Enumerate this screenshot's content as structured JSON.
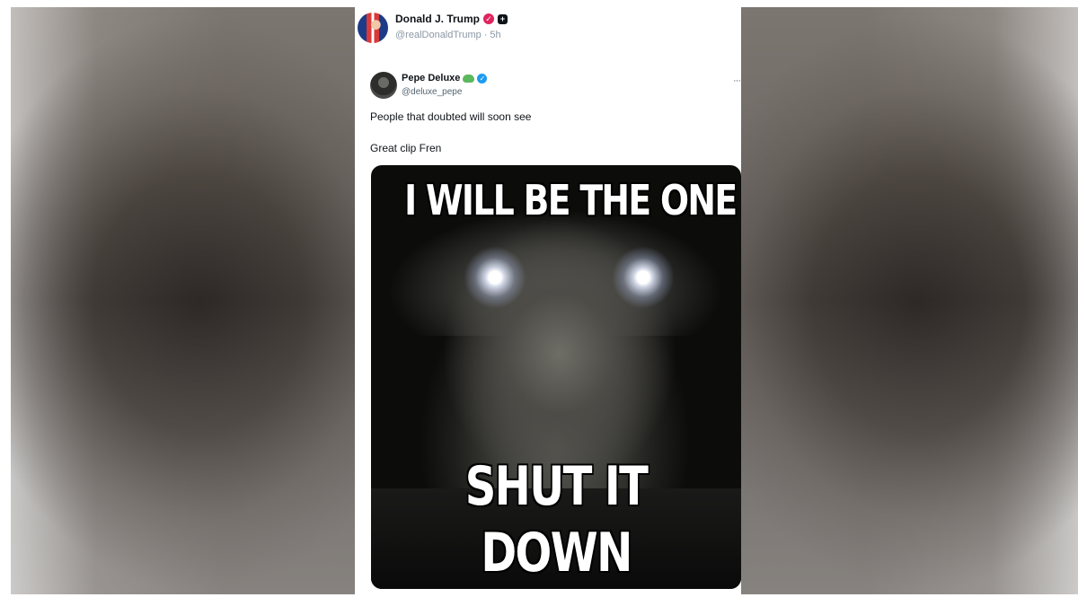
{
  "post": {
    "author_name": "Donald J. Trump",
    "author_handle": "@realDonaldTrump",
    "separator": "·",
    "time": "5h"
  },
  "quoted_post": {
    "author_name": "Pepe Deluxe",
    "author_handle": "@deluxe_pepe",
    "more_label": "···",
    "line1": "People that doubted will soon see",
    "line2": "Great clip Fren"
  },
  "meme": {
    "top_text": "I WILL BE THE ONE TO",
    "bottom_text_1": "SHUT IT",
    "bottom_text_2": "DOWN"
  },
  "colors": {
    "verified_blue": "#1d9bf0",
    "badge_pink": "#e0245e",
    "text_primary": "#0f1419",
    "text_secondary": "#536471"
  },
  "icons": [
    "verified-badge-icon",
    "frog-emoji-icon",
    "more-options-icon"
  ]
}
